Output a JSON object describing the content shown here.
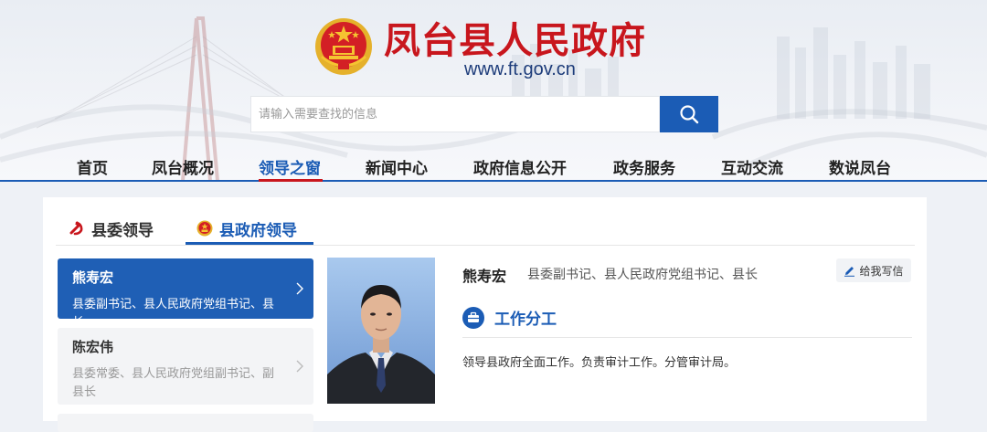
{
  "header": {
    "site_title": "凤台县人民政府",
    "site_url": "www.ft.gov.cn",
    "search_placeholder": "请输入需要查找的信息"
  },
  "nav": {
    "items": [
      "首页",
      "凤台概况",
      "领导之窗",
      "新闻中心",
      "政府信息公开",
      "政务服务",
      "互动交流",
      "数说凤台"
    ],
    "active_index": 2
  },
  "tabs": {
    "party": "县委领导",
    "government": "县政府领导",
    "active": "government"
  },
  "leaders": [
    {
      "name": "熊寿宏",
      "title": "县委副书记、县人民政府党组书记、县长",
      "selected": true
    },
    {
      "name": "陈宏伟",
      "title": "县委常委、县人民政府党组副书记、副县长",
      "selected": false
    }
  ],
  "detail": {
    "name": "熊寿宏",
    "title": "县委副书记、县人民政府党组书记、县长",
    "write_label": "给我写信",
    "section_label": "工作分工",
    "duties": "领导县政府全面工作。负责审计工作。分管审计局。"
  },
  "colors": {
    "brand_blue": "#1b5cb5",
    "brand_red": "#c8161d",
    "selected_bg": "#1f5fb5"
  }
}
